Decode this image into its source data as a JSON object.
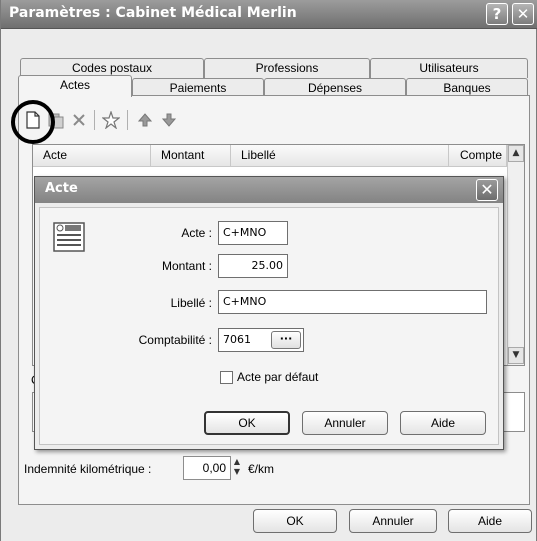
{
  "window": {
    "title": "Paramètres : Cabinet Médical Merlin",
    "help_glyph": "?",
    "close_glyph": "✕"
  },
  "tabs_row1": [
    "Codes postaux",
    "Professions",
    "Utilisateurs"
  ],
  "tabs_row2": [
    "Actes",
    "Paiements",
    "Dépenses",
    "Banques"
  ],
  "active_tab": "Actes",
  "toolbar": {
    "icons": [
      "new-document-icon",
      "copy-icon",
      "delete-icon",
      "star-icon",
      "arrow-up-icon",
      "arrow-down-icon"
    ]
  },
  "list": {
    "columns": [
      "Acte",
      "Montant",
      "Libellé",
      "Compte"
    ]
  },
  "behind_label": "C",
  "km": {
    "label": "Indemnité  kilométrique :",
    "value": "0,00",
    "unit": "€/km"
  },
  "main_buttons": {
    "ok": "OK",
    "cancel": "Annuler",
    "help": "Aide"
  },
  "dialog": {
    "title": "Acte",
    "close_glyph": "✕",
    "acte_label": "Acte :",
    "acte_value": "C+MNO",
    "montant_label": "Montant :",
    "montant_value": "25.00",
    "libelle_label": "Libellé :",
    "libelle_value": "C+MNO",
    "compta_label": "Comptabilité :",
    "compta_value": "7061",
    "compta_browse": "···",
    "default_checkbox_label": "Acte par défaut",
    "default_checked": false,
    "ok": "OK",
    "cancel": "Annuler",
    "help": "Aide"
  },
  "colors": {
    "title_bar": "#7d7d7d",
    "window_bg": "#ececec",
    "panel_bg": "#f4f4f4"
  }
}
